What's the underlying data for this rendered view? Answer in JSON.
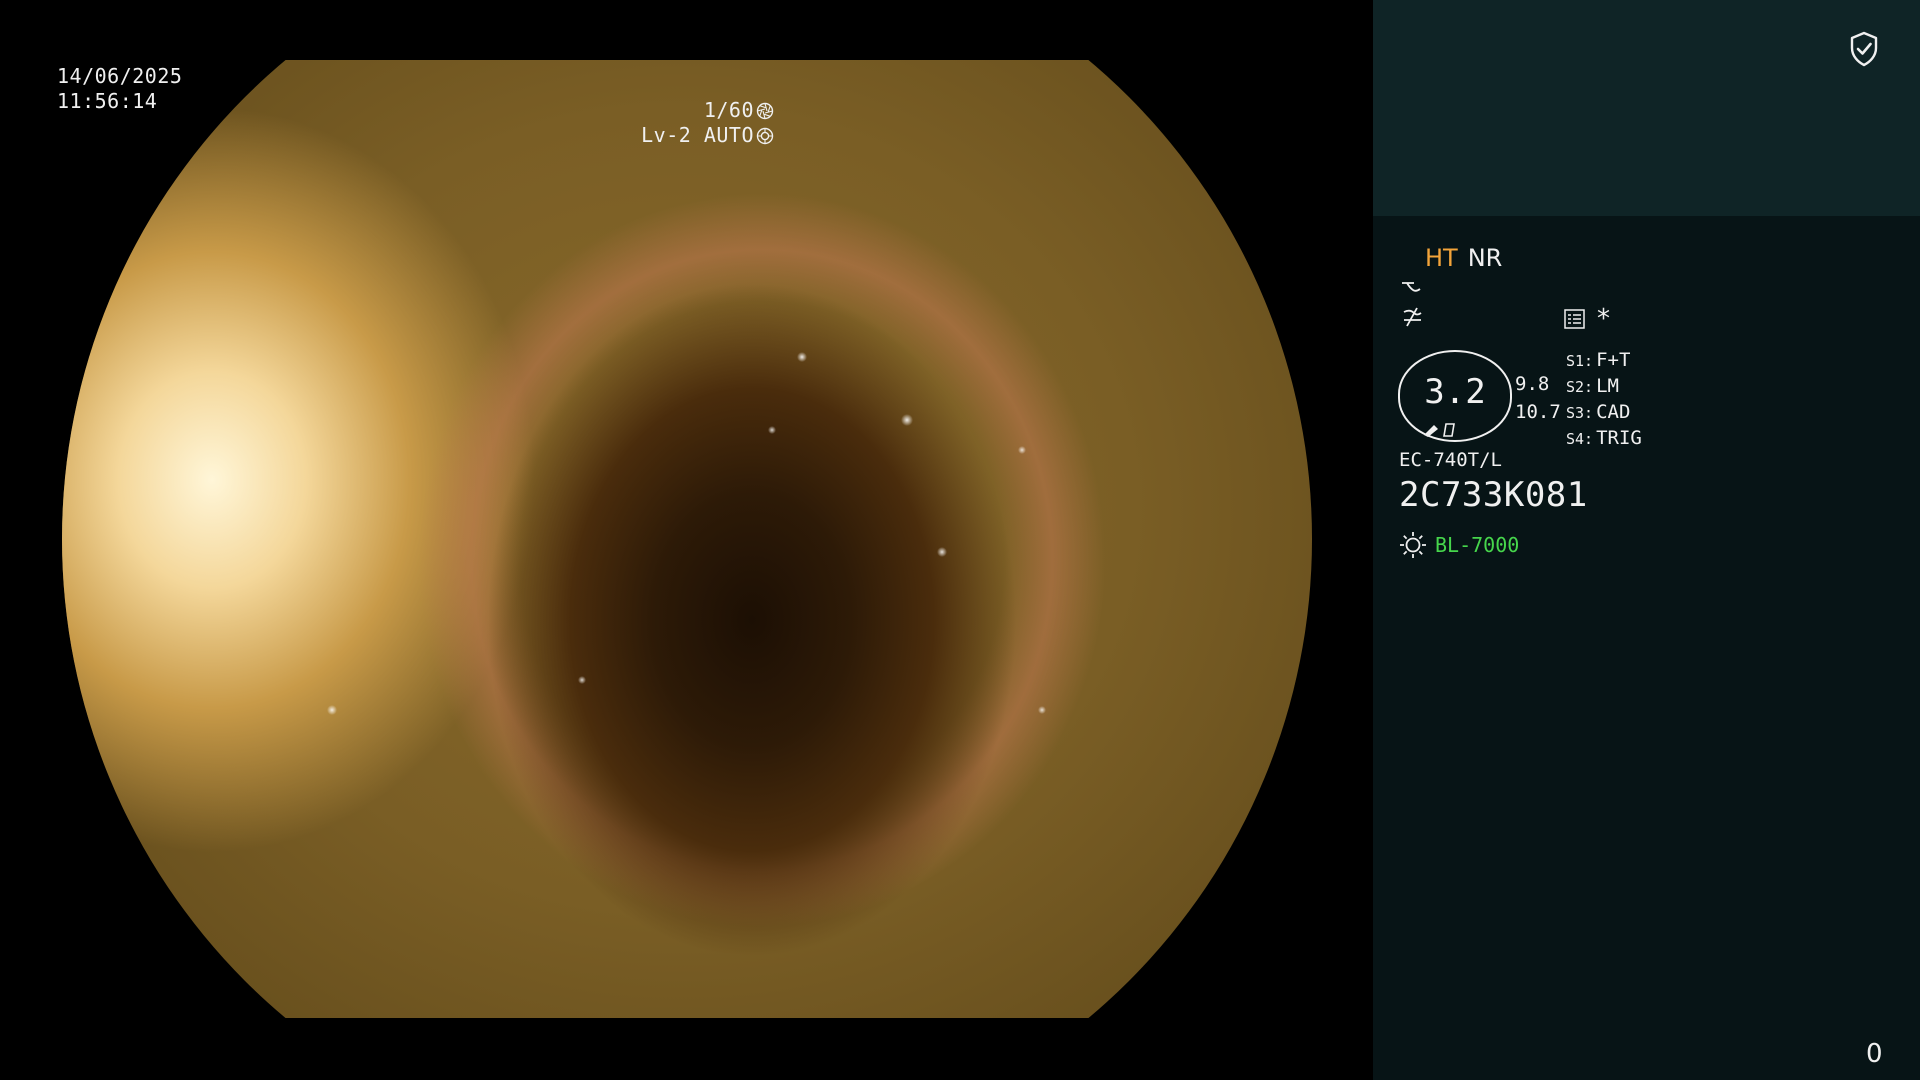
{
  "overlay": {
    "date": "14/06/2025",
    "time": "11:56:14",
    "shutter": "1/60",
    "shutter_icon": "aperture-icon",
    "level": "Lv-2 AUTO",
    "level_icon": "iris-icon"
  },
  "panel": {
    "status_icon": "shield-check-icon",
    "ht_label": "HT",
    "nr_label": "NR",
    "asterisk": "*",
    "gauge_value": "3.2",
    "side_values": [
      "9.8",
      "10.7"
    ],
    "modes": [
      {
        "key": "S1:",
        "value": "F+T"
      },
      {
        "key": "S2:",
        "value": "LM"
      },
      {
        "key": "S3:",
        "value": "CAD"
      },
      {
        "key": "S4:",
        "value": "TRIG"
      }
    ],
    "scope_model": "EC-740T/L",
    "serial": "2C733K081",
    "light_source": "BL-7000",
    "counter": "0"
  },
  "colors": {
    "ht": "#f3a43a",
    "light_source": "#46d64c",
    "panel_top": "#0f2426",
    "panel_bottom": "#071416"
  }
}
